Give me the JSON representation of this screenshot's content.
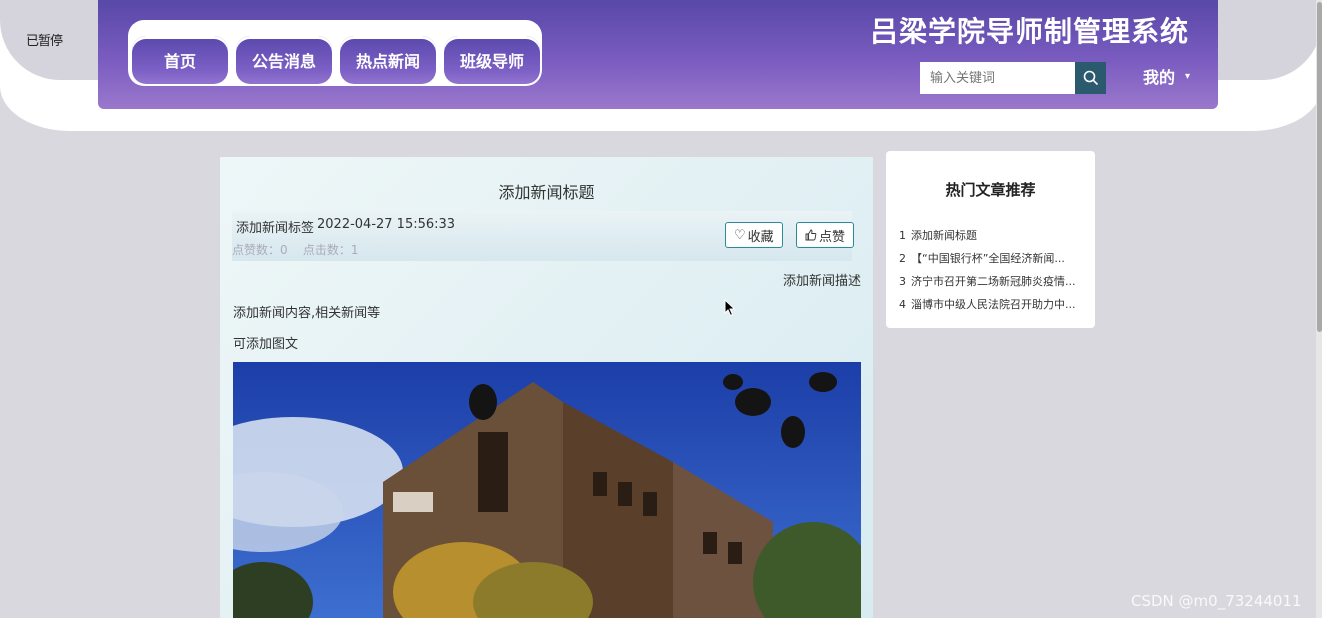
{
  "status": {
    "text": "已暂停"
  },
  "header": {
    "nav": [
      {
        "label": "首页"
      },
      {
        "label": "公告消息"
      },
      {
        "label": "热点新闻"
      },
      {
        "label": "班级导师"
      }
    ],
    "site_title": "吕梁学院导师制管理系统",
    "search": {
      "placeholder": "输入关键词"
    },
    "mine_label": "我的"
  },
  "article": {
    "title": "添加新闻标题",
    "tag": "添加新闻标签",
    "date": "2022-04-27 15:56:33",
    "likes_label": "点赞数：0",
    "clicks_label": "点击数：1",
    "favorite_label": "收藏",
    "like_label": "点赞",
    "description": "添加新闻描述",
    "content": [
      "添加新闻内容,相关新闻等",
      "可添加图文"
    ]
  },
  "sidebar": {
    "title": "热门文章推荐",
    "items": [
      {
        "num": "1",
        "text": "添加新闻标题"
      },
      {
        "num": "2",
        "text": "【“中国银行杯”全国经济新闻..."
      },
      {
        "num": "3",
        "text": "济宁市召开第二场新冠肺炎疫情..."
      },
      {
        "num": "4",
        "text": "淄博市中级人民法院召开助力中..."
      }
    ]
  },
  "watermark": "CSDN @m0_73244011",
  "colors": {
    "header_purple": "#6a52b6",
    "search_button": "#2b5a6e",
    "button_border": "#2b8a95"
  }
}
